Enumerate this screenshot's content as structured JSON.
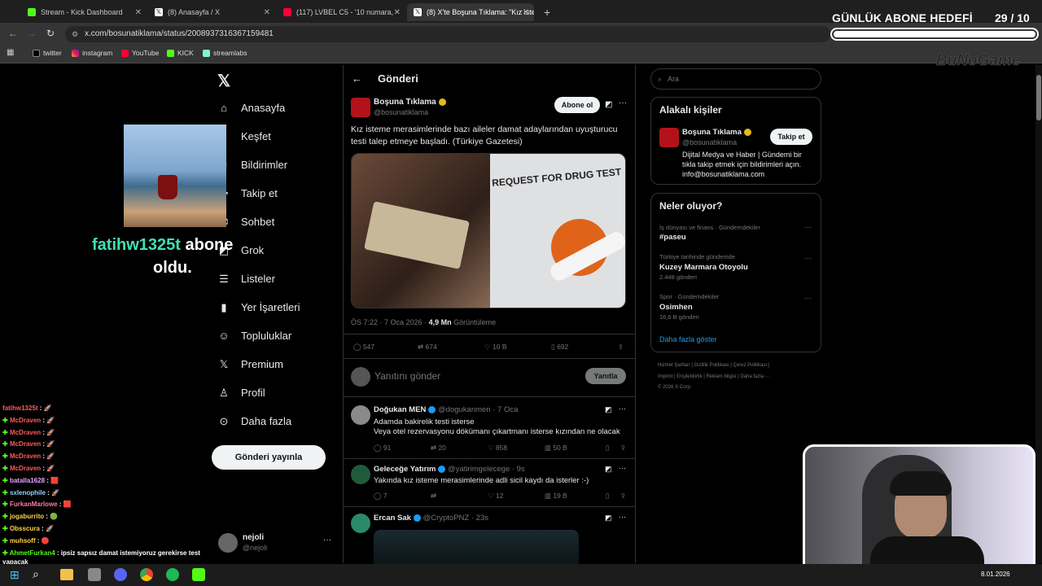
{
  "browser": {
    "tabs": [
      {
        "title": "Stream - Kick Dashboard",
        "color": "#53fc18"
      },
      {
        "title": "(8) Anasayfa / X",
        "color": "#e7e9ea"
      },
      {
        "title": "(117) LVBEL C5 - '10 numara, -",
        "color": "#ff0033"
      },
      {
        "title": "(8) X'te Boşuna Tıklama: \"Kız iste",
        "color": "#e7e9ea"
      }
    ],
    "url": "x.com/bosunatiklama/status/2008937316367159481",
    "bookmarks": [
      "twitter",
      "instagram",
      "YouTube",
      "KICK",
      "streamlabs"
    ]
  },
  "overlay": {
    "goal_title": "GÜNLÜK ABONE HEDEFİ",
    "goal_count": "29  / 10",
    "goal_progress": 1.0,
    "brand": "BuNoGame",
    "sub_user": "fatihw1325t",
    "sub_word": "abone",
    "sub_text2": "oldu."
  },
  "x_nav": [
    {
      "label": "Anasayfa",
      "icon": "home-icon"
    },
    {
      "label": "Keşfet",
      "icon": "search-icon"
    },
    {
      "label": "Bildirimler",
      "icon": "bell-icon"
    },
    {
      "label": "Takip et",
      "icon": "follow-icon"
    },
    {
      "label": "Sohbet",
      "icon": "chat-icon"
    },
    {
      "label": "Grok",
      "icon": "grok-icon"
    },
    {
      "label": "Listeler",
      "icon": "list-icon"
    },
    {
      "label": "Yer İşaretleri",
      "icon": "bookmark-icon"
    },
    {
      "label": "Topluluklar",
      "icon": "community-icon"
    },
    {
      "label": "Premium",
      "icon": "x-logo-icon"
    },
    {
      "label": "Profil",
      "icon": "person-icon"
    },
    {
      "label": "Daha fazla",
      "icon": "more-circle-icon"
    }
  ],
  "post_button": "Gönderi yayınla",
  "account": {
    "name": "nejoli",
    "handle": "@nejoli"
  },
  "main": {
    "header": "Gönderi",
    "author_name": "Boşuna Tıklama",
    "author_handle": "@bosunatiklama",
    "subscribe": "Abone ol",
    "text": "Kız isteme merasimlerinde bazı aileler damat adaylarından uyuşturucu testi talep etmeye başladı. (Türkiye Gazetesi)",
    "image_text": "REQUEST FOR DRUG TEST",
    "timestamp": "ÖS 7:22 · 7 Oca 2026 · ",
    "views": "4,9 Mn",
    "views_label": "Görüntüleme",
    "stats": {
      "replies": "547",
      "reposts": "674",
      "likes": "10 B",
      "bookmarks": "692"
    },
    "reply_placeholder": "Yanıtını gönder",
    "reply_button": "Yanıtla"
  },
  "replies": [
    {
      "name": "Doğukan MEN",
      "handle": "@dogukanmen · 7 Oca",
      "text1": "Adamda bakirelik testi isterse",
      "text2": "Veya otel rezervasyonu dökümanı çıkartmanı isterse kızından ne olacak",
      "replies": "91",
      "reposts": "20",
      "likes": "858",
      "views": "50 B"
    },
    {
      "name": "Geleceğe Yatırım",
      "handle": "@yatirimgelecege · 9s",
      "text1": "Yakında kız isteme merasimlerinde adli sicil kaydı da isterler :-)",
      "replies": "7",
      "reposts": "",
      "likes": "12",
      "views": "19 B"
    },
    {
      "name": "Ercan Sak",
      "handle": "@CryptoPNZ · 23s"
    }
  ],
  "right": {
    "search_placeholder": "Ara",
    "relevant_title": "Alakalı kişiler",
    "rel_name": "Boşuna Tıklama",
    "rel_handle": "@bosunatiklama",
    "follow": "Takip et",
    "rel_bio": "Dijital Medya ve Haber | Gündemi bir tıkla takip etmek için bildirimleri açın. info@bosunatiklama.com",
    "trends_title": "Neler oluyor?",
    "trends": [
      {
        "context": "İş dünyası ve finans · Gündemdekiler",
        "topic": "#paseu",
        "count": ""
      },
      {
        "context": "Türkiye tarihinde gündemde",
        "topic": "Kuzey Marmara Otoyolu",
        "count": "2.448 gönderi"
      },
      {
        "context": "Spor · Gündemdekiler",
        "topic": "Osimhen",
        "count": "16,6 B gönderi"
      }
    ],
    "show_more": "Daha fazla göster",
    "footer1": "Hizmet Şartları  |  Gizlilik Politikası  |  Çerez Politikası  |",
    "footer2": "Imprint  |  Erişilebilirlik  |  Reklam bilgisi  |  Daha fazla ···",
    "footer3": "© 2026 X Corp."
  },
  "chat": [
    {
      "user": "fatihw1325t",
      "msg": ": 🚀",
      "color": "#ff5a5a"
    },
    {
      "user": "McDraven",
      "msg": ": 🚀",
      "color": "#ff5a5a"
    },
    {
      "user": "McDraven",
      "msg": ": 🚀",
      "color": "#ff5a5a"
    },
    {
      "user": "McDraven",
      "msg": ": 🚀",
      "color": "#ff5a5a"
    },
    {
      "user": "McDraven",
      "msg": ": 🚀",
      "color": "#ff5a5a"
    },
    {
      "user": "McDraven",
      "msg": ": 🚀",
      "color": "#ff5a5a"
    },
    {
      "user": "batalla1628",
      "msg": ": 🟥",
      "color": "#e8a0ff"
    },
    {
      "user": "sxlenophile",
      "msg": ": 🚀",
      "color": "#8ad8ff"
    },
    {
      "user": "FurkanMarlowe",
      "msg": ": 🟥",
      "color": "#ff7a9a"
    },
    {
      "user": "jogaburrito",
      "msg": ": 🟢",
      "color": "#ffd24a"
    },
    {
      "user": "Obsscura",
      "msg": ": 🚀",
      "color": "#ffd24a"
    },
    {
      "user": "muhsoff",
      "msg": ": 🔴",
      "color": "#ffd24a"
    },
    {
      "user": "AhmetFurkan4",
      "msg": ": ipsiz sapsız damat istemiyoruz gerekirse test",
      "color": "#53fc18"
    }
  ],
  "chat_wrap": "yapacak",
  "taskbar": {
    "date": "8.01.2026"
  }
}
